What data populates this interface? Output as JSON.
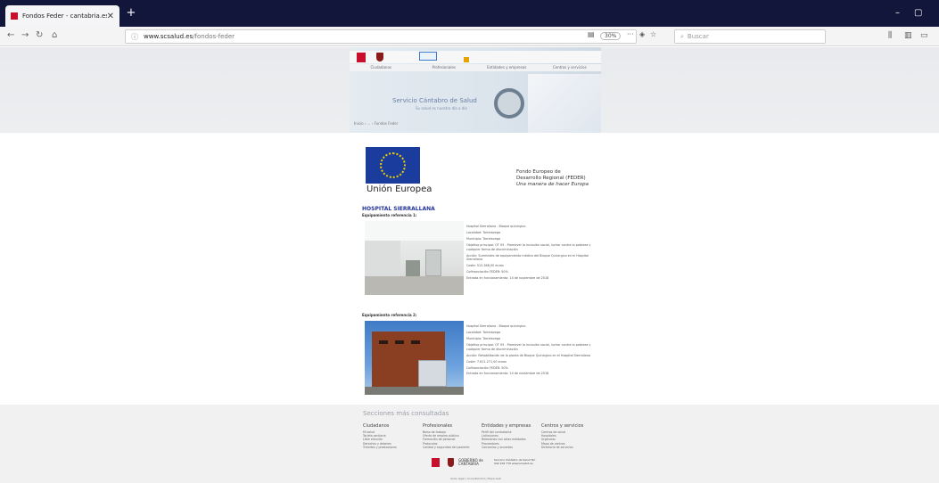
{
  "browser": {
    "tab_title": "Fondos Feder - cantabria.es",
    "tab_close": "✕",
    "new_tab": "+",
    "url_domain": "www.scsalud.es",
    "url_path": "/fondos-feder",
    "zoom": "30%",
    "search_placeholder": "Buscar"
  },
  "header": {
    "menu": [
      "Ciudadanos",
      "Profesionales",
      "Entidades y empresas",
      "Centros y servicios"
    ],
    "site_title": "Servicio Cántabro de Salud",
    "site_subtitle": "Su salud es nuestro día a día",
    "breadcrumb": "Inicio › ... › Fondos Feder"
  },
  "eu": {
    "label": "Unión Europea",
    "fund_line1": "Fondo Europeo de",
    "fund_line2": "Desarrollo Regional (FEDER)",
    "motto": "Una manera de hacer Europa"
  },
  "main": {
    "hospital": "HOSPITAL SIERRALLANA",
    "items": [
      {
        "title": "Equipamiento referencia 1:",
        "lines": [
          "Hospital Sierrallana - Bloque quirúrgico",
          "Localidad: Torrelavega",
          "Municipio: Torrelavega",
          "Objetivo principal: OT 09 - Promover la inclusión social, luchar contra la pobreza y cualquier forma de discriminación",
          "Acción: Suministro de equipamiento médico del Bloque Quirúrgico en el Hospital Sierrallana",
          "Coste: 512.368,00 euros",
          "Cofinanciación FEDER: 50%",
          "Entrada en funcionamiento: 14 de noviembre de 2018"
        ]
      },
      {
        "title": "Equipamiento referencia 2:",
        "lines": [
          "Hospital Sierrallana - Bloque quirúrgico",
          "Localidad: Torrelavega",
          "Municipio: Torrelavega",
          "Objetivo principal: OT 09 - Promover la inclusión social, luchar contra la pobreza y cualquier forma de discriminación",
          "Acción: Rehabilitación de la planta de Bloque Quirúrgico en el Hospital Sierrallana",
          "Coste: 7.811.271,00 euros",
          "Cofinanciación FEDER: 50%",
          "Entrada en funcionamiento: 14 de noviembre de 2018"
        ]
      }
    ]
  },
  "footer": {
    "title": "Secciones más consultadas",
    "columns": [
      {
        "head": "Ciudadanos",
        "items": [
          "Mi salud",
          "Tarjeta sanitaria",
          "Libre elección",
          "Derechos y deberes",
          "Trámites y prestaciones"
        ]
      },
      {
        "head": "Profesionales",
        "items": [
          "Bolsa de trabajo",
          "Oferta de empleo público",
          "Formación de personal",
          "Protocolos",
          "Calidad y seguridad del paciente"
        ]
      },
      {
        "head": "Entidades y empresas",
        "items": [
          "Perfil del contratante",
          "Licitaciones",
          "Relaciones con otras entidades",
          "Proveedores",
          "Convenios y acuerdos"
        ]
      },
      {
        "head": "Centros y servicios",
        "items": [
          "Centros de salud",
          "Hospitales",
          "Urgencias",
          "Mapa de centros",
          "Directorio de servicios"
        ]
      }
    ],
    "gov": "GOBIERNO de CANTABRIA",
    "contact": "Servicio Cántabro de Salud Tel. 942 202 770 www.scsalud.es",
    "links": "Aviso legal | Accesibilidad | Mapa web"
  }
}
